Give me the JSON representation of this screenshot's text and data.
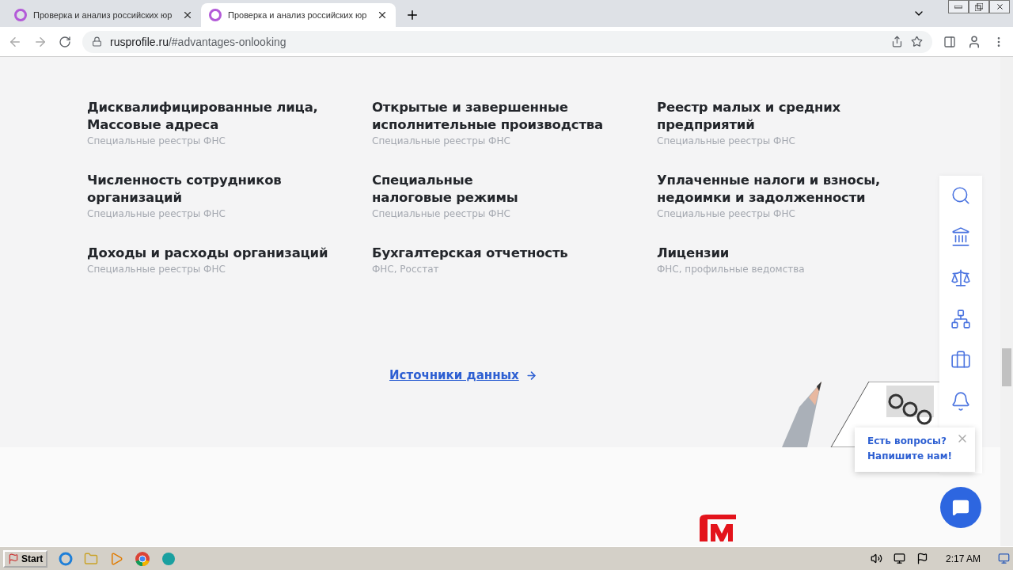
{
  "browser": {
    "tabs": [
      {
        "title": "Проверка и анализ российских юр",
        "selected": false
      },
      {
        "title": "Проверка и анализ российских юр",
        "selected": true
      }
    ],
    "url_host": "rusprofile.ru",
    "url_path": "/#advantages-onlooking"
  },
  "sources": [
    {
      "title": "Дисквалифицированные лица,\nМассовые адреса",
      "source": "Специальные реестры ФНС"
    },
    {
      "title": "Открытые и завершенные\nисполнительные производства",
      "source": "Специальные реестры ФНС"
    },
    {
      "title": "Реестр малых и средних\nпредприятий",
      "source": "Специальные реестры ФНС"
    },
    {
      "title": "Численность сотрудников\nорганизаций",
      "source": "Специальные реестры ФНС"
    },
    {
      "title": "Специальные\nналоговые режимы",
      "source": "Специальные реестры ФНС"
    },
    {
      "title": "Уплаченные налоги и взносы,\nнедоимки и задолженности",
      "source": "Специальные реестры ФНС"
    },
    {
      "title": "Доходы и расходы организаций",
      "source": "Специальные реестры ФНС"
    },
    {
      "title": "Бухгалтерская отчетность",
      "source": "ФНС, Росстат"
    },
    {
      "title": "Лицензии",
      "source": "ФНС, профильные ведомства"
    }
  ],
  "sources_link": "Источники данных",
  "chat_popup": {
    "line1": "Есть вопросы?",
    "line2": "Напишите нам!"
  },
  "taskbar": {
    "start": "Start",
    "clock": "2:17 AM"
  }
}
